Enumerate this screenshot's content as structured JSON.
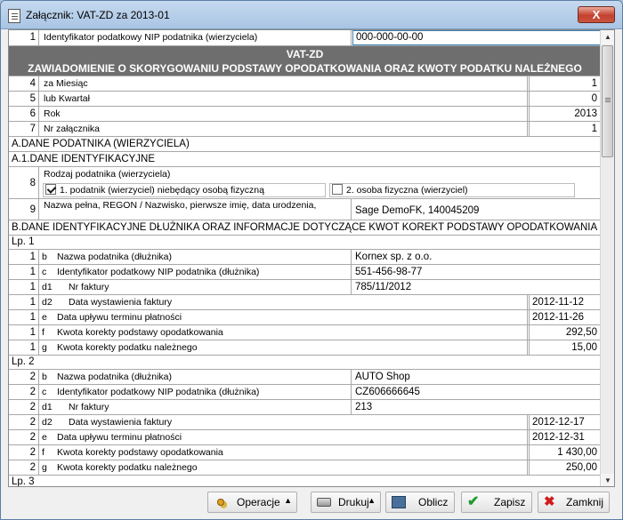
{
  "window": {
    "title": "Załącznik: VAT-ZD za 2013-01",
    "close_label": "X"
  },
  "form": {
    "row1": {
      "num": "1",
      "label": "Identyfikator podatkowy NIP podatnika (wierzyciela)",
      "value": "000-000-00-00"
    },
    "header": {
      "line1": "VAT-ZD",
      "line2": "ZAWIADOMIENIE O SKORYGOWANIU PODSTAWY OPODATKOWANIA ORAZ KWOTY PODATKU NALEŻNEGO"
    },
    "period_rows": [
      {
        "num": "4",
        "label": "za Miesiąc",
        "value": "1"
      },
      {
        "num": "5",
        "label": "lub Kwartał",
        "value": "0"
      },
      {
        "num": "6",
        "label": "Rok",
        "value": "2013"
      },
      {
        "num": "7",
        "label": "Nr załącznika",
        "value": "1"
      }
    ],
    "section_a": "A.DANE PODATNIKA (WIERZYCIELA)",
    "section_a1": "A.1.DANE IDENTYFIKACYJNE",
    "row8": {
      "num": "8",
      "label": "Rodzaj podatnika (wierzyciela)",
      "option1": "1. podatnik (wierzyciel) niebędący osobą fizyczną",
      "option2": "2. osoba fizyczna (wierzyciel)",
      "option1_checked": true,
      "option2_checked": false
    },
    "row9": {
      "num": "9",
      "label": "Nazwa pełna, REGON / Nazwisko, pierwsze imię, data urodzenia,",
      "value": "Sage DemoFK, 140045209"
    },
    "section_b": "B.DANE IDENTYFIKACYJNE DŁUŻNIKA ORAZ INFORMACJE DOTYCZĄCE KWOT KOREKT PODSTAWY OPODATKOWANIA ORAZ",
    "lp1": {
      "title": "Lp. 1",
      "rows": [
        {
          "num": "1",
          "code": "b",
          "label": "Nazwa podatnika (dłużnika)",
          "value": "Kornex sp. z o.o."
        },
        {
          "num": "1",
          "code": "c",
          "label": "Identyfikator podatkowy NIP podatnika (dłużnika)",
          "value": "551-456-98-77"
        },
        {
          "num": "1",
          "code": "d1",
          "label": "Nr faktury",
          "value": "785/11/2012"
        },
        {
          "num": "1",
          "code": "d2",
          "label": "Data wystawienia faktury",
          "value": "2012-11-12"
        },
        {
          "num": "1",
          "code": "e",
          "label": "Data upływu terminu płatności",
          "value": "2012-11-26"
        },
        {
          "num": "1",
          "code": "f",
          "label": "Kwota korekty podstawy opodatkowania",
          "value": "292,50"
        },
        {
          "num": "1",
          "code": "g",
          "label": "Kwota korekty podatku należnego",
          "value": "15,00"
        }
      ]
    },
    "lp2": {
      "title": "Lp. 2",
      "rows": [
        {
          "num": "2",
          "code": "b",
          "label": "Nazwa podatnika (dłużnika)",
          "value": "AUTO Shop"
        },
        {
          "num": "2",
          "code": "c",
          "label": "Identyfikator podatkowy NIP podatnika (dłużnika)",
          "value": "CZ606666645"
        },
        {
          "num": "2",
          "code": "d1",
          "label": "Nr faktury",
          "value": "213"
        },
        {
          "num": "2",
          "code": "d2",
          "label": "Data wystawienia faktury",
          "value": "2012-12-17"
        },
        {
          "num": "2",
          "code": "e",
          "label": "Data upływu terminu płatności",
          "value": "2012-12-31"
        },
        {
          "num": "2",
          "code": "f",
          "label": "Kwota korekty podstawy opodatkowania",
          "value": "1 430,00"
        },
        {
          "num": "2",
          "code": "g",
          "label": "Kwota korekty podatku należnego",
          "value": "250,00"
        }
      ]
    },
    "lp3": {
      "title": "Lp. 3"
    }
  },
  "toolbar": {
    "operacje": "Operacje",
    "drukuj": "Drukuj",
    "oblicz": "Oblicz",
    "zapisz": "Zapisz",
    "zamknij": "Zamknij"
  },
  "icons": {
    "operacje": "gears-icon",
    "drukuj": "printer-icon",
    "oblicz": "calculator-icon",
    "zapisz": "checkmark-icon",
    "zamknij": "x-icon"
  }
}
